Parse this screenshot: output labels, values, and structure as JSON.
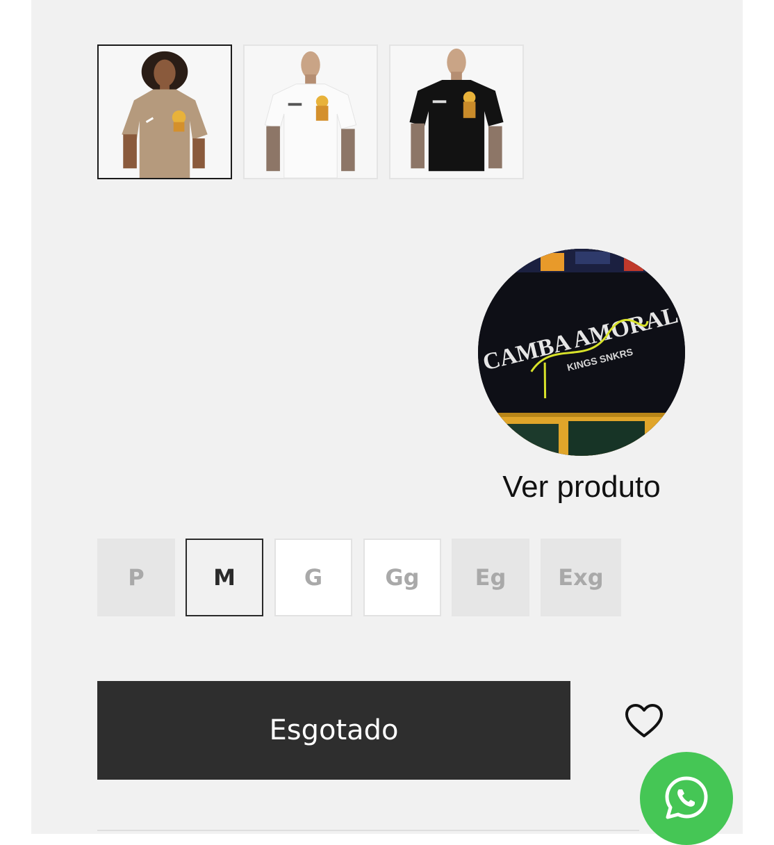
{
  "thumbnails": [
    {
      "icon": "model-woman-beige-tshirt",
      "shirt_color": "#b59a7d",
      "selected": true
    },
    {
      "icon": "model-man-white-tshirt",
      "shirt_color": "#fbfbfb",
      "selected": false
    },
    {
      "icon": "model-man-black-tshirt",
      "shirt_color": "#121212",
      "selected": false
    }
  ],
  "look": {
    "label": "Ver produto",
    "image_text": "CAMBA AMORAL",
    "image_subtext": "KINGS SNKRS"
  },
  "sizes": [
    {
      "label": "P",
      "state": "unavailable"
    },
    {
      "label": "M",
      "state": "selected"
    },
    {
      "label": "G",
      "state": "available"
    },
    {
      "label": "Gg",
      "state": "available"
    },
    {
      "label": "Eg",
      "state": "unavailable"
    },
    {
      "label": "Exg",
      "state": "unavailable"
    }
  ],
  "buy_button": {
    "label": "Esgotado"
  },
  "icons": {
    "wishlist": "heart-outline-icon",
    "whatsapp": "whatsapp-icon"
  },
  "colors": {
    "panel_bg": "#f1f1f1",
    "button_bg": "#2e2e2e",
    "whatsapp_green": "#45c655"
  }
}
